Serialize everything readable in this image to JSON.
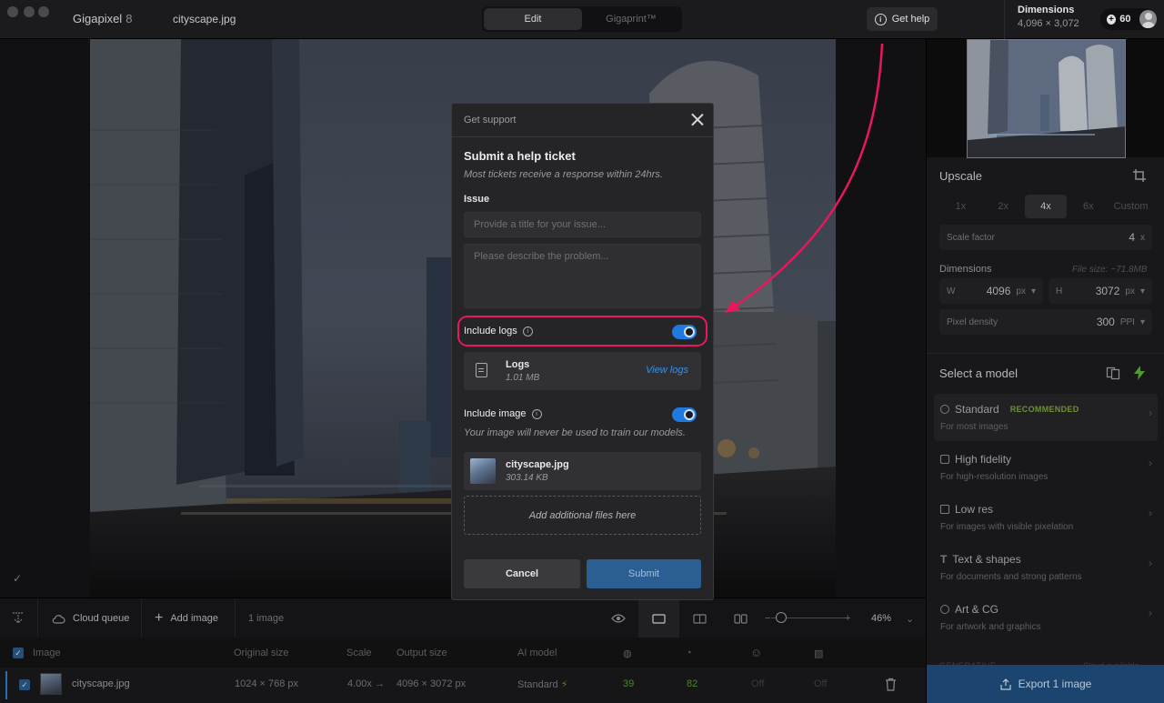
{
  "titlebar": {
    "app_name": "Gigapixel",
    "app_version": "8",
    "file_name": "cityscape.jpg",
    "modes": [
      "Edit",
      "Gigaprint™"
    ],
    "get_help": "Get help",
    "dimensions_title": "Dimensions",
    "dimensions_value": "4,096 × 3,072",
    "credits": "60"
  },
  "right_panel": {
    "upscale_title": "Upscale",
    "scale_options": [
      "1x",
      "2x",
      "4x",
      "6x",
      "Custom"
    ],
    "scale_factor_label": "Scale factor",
    "scale_factor_value": "4",
    "scale_factor_unit": "x",
    "dimensions_label": "Dimensions",
    "file_size": "File size: ~71.8MB",
    "width_label": "W",
    "width_value": "4096",
    "height_label": "H",
    "height_value": "3072",
    "px_unit": "px",
    "pixel_density_label": "Pixel density",
    "pixel_density_value": "300",
    "pixel_density_unit": "PPI",
    "select_model_title": "Select a model",
    "models": [
      {
        "name": "Standard",
        "badge": "RECOMMENDED",
        "sub": "For most images"
      },
      {
        "name": "High fidelity",
        "sub": "For high-resolution images"
      },
      {
        "name": "Low res",
        "sub": "For images with visible pixelation"
      },
      {
        "name": "Text & shapes",
        "sub": "For documents and strong patterns"
      },
      {
        "name": "Art & CG",
        "sub": "For artwork and graphics"
      }
    ],
    "generative_label": "GENERATIVE",
    "cloud_available": "Cloud available",
    "export_label": "Export 1 image"
  },
  "toolbar": {
    "cloud_queue": "Cloud queue",
    "add_image": "Add image",
    "image_count": "1 image",
    "zoom": "46%"
  },
  "table": {
    "headers": [
      "Image",
      "Original size",
      "Scale",
      "Output size",
      "AI model"
    ],
    "row": {
      "name": "cityscape.jpg",
      "original_size": "1024 × 768 px",
      "scale": "4.00x →",
      "output_size": "4096 × 3072 px",
      "model": "Standard",
      "score1": "39",
      "score2": "82",
      "off1": "Off",
      "off2": "Off"
    }
  },
  "modal": {
    "header": "Get support",
    "title": "Submit a help ticket",
    "subtitle": "Most tickets receive a response within 24hrs.",
    "issue_label": "Issue",
    "title_placeholder": "Provide a title for your issue...",
    "desc_placeholder": "Please describe the problem...",
    "include_logs": "Include logs",
    "logs_name": "Logs",
    "logs_size": "1.01 MB",
    "view_logs": "View logs",
    "include_image": "Include image",
    "image_note": "Your image will never be used to train our models.",
    "image_name": "cityscape.jpg",
    "image_size": "303.14 KB",
    "dropzone": "Add additional files here",
    "cancel": "Cancel",
    "submit": "Submit"
  },
  "colors": {
    "accent_blue": "#1f7ae0",
    "highlight_pink": "#e8185c",
    "recommended_green": "#6f8f3a"
  }
}
